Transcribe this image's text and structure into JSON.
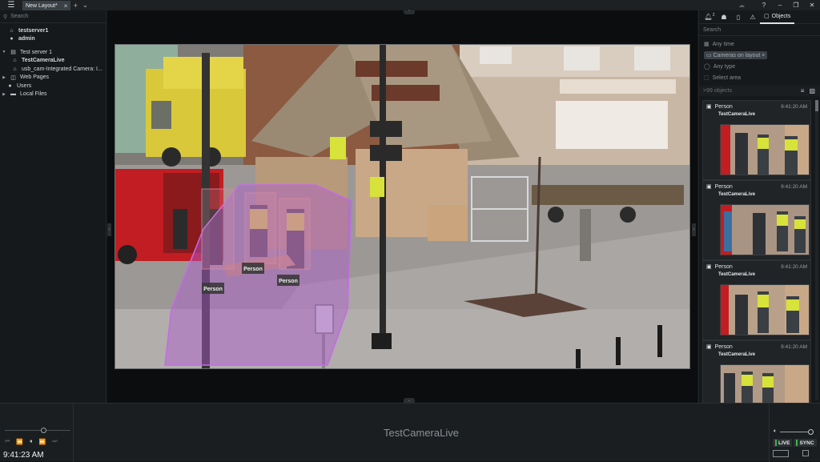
{
  "tabs": [
    {
      "label": "New Layout*"
    }
  ],
  "left_panel": {
    "search_placeholder": "Search",
    "server": "testserver1",
    "user": "admin",
    "tree": [
      {
        "label": "Test server 1"
      },
      {
        "label": "TestCameraLive"
      },
      {
        "label": "usb_cam-Integrated Camera: I..."
      },
      {
        "label": "Web Pages"
      },
      {
        "label": "Users"
      },
      {
        "label": "Local Files"
      }
    ]
  },
  "video": {
    "detections": [
      {
        "label": "Person"
      },
      {
        "label": "Person"
      },
      {
        "label": "Person"
      }
    ]
  },
  "right_panel": {
    "notification_count": "2",
    "objects_tab": "Objects",
    "search_placeholder": "Search",
    "filters": {
      "time": "Any time",
      "cameras": "Cameras on layout",
      "type": "Any type",
      "area": "Select area"
    },
    "count": ">99 objects",
    "tiles": [
      {
        "label": "Person",
        "time": "9:41:20 AM",
        "camera": "TestCameraLive"
      },
      {
        "label": "Person",
        "time": "9:41:20 AM",
        "camera": "TestCameraLive"
      },
      {
        "label": "Person",
        "time": "9:41:20 AM",
        "camera": "TestCameraLive"
      },
      {
        "label": "Person",
        "time": "9:41:20 AM",
        "camera": "TestCameraLive"
      }
    ]
  },
  "bottom": {
    "clock": "9:41:23 AM",
    "camera_name": "TestCameraLive",
    "live": "LIVE",
    "sync": "SYNC"
  }
}
